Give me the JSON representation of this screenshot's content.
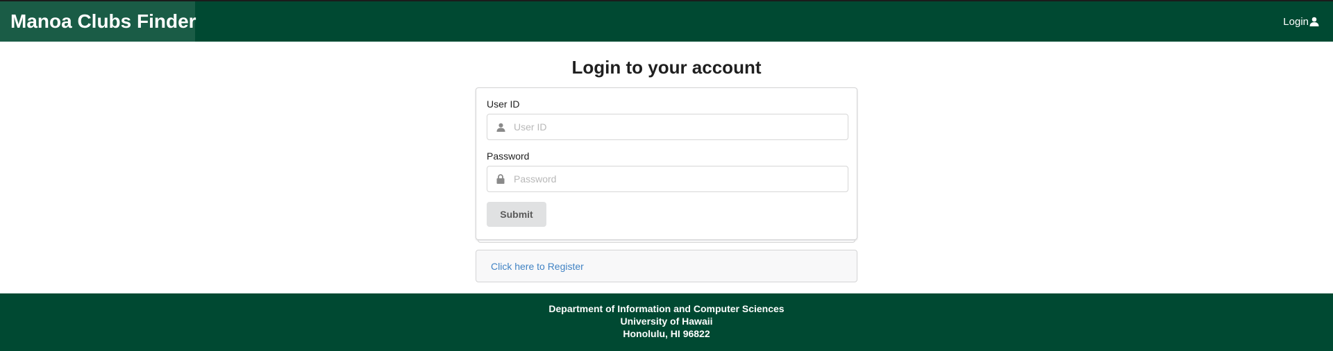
{
  "navbar": {
    "brand": "Manoa Clubs Finder",
    "login_label": "Login",
    "background": "#004932",
    "brand_background": "#1a5c46"
  },
  "main": {
    "title": "Login to your account",
    "form": {
      "userid_label": "User ID",
      "userid_placeholder": "User ID",
      "userid_icon": "user-icon",
      "password_label": "Password",
      "password_placeholder": "Password",
      "password_icon": "lock-icon",
      "submit_label": "Submit"
    },
    "register_link": "Click here to Register",
    "link_color": "#4183c4"
  },
  "footer": {
    "lines": [
      "Department of Information and Computer Sciences",
      "University of Hawaii",
      "Honolulu, HI 96822"
    ]
  }
}
